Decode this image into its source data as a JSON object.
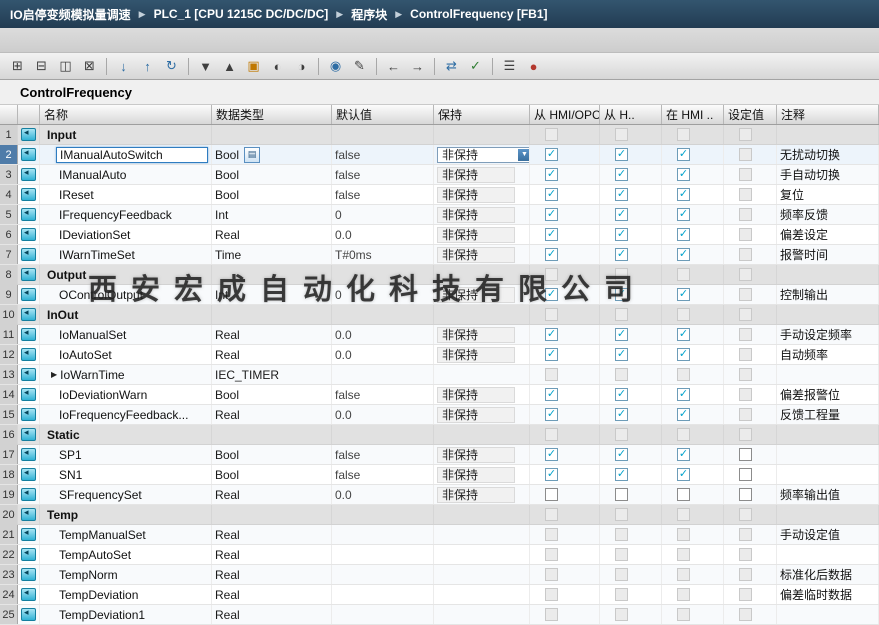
{
  "breadcrumb": {
    "items": [
      "IO启停变频模拟量调速",
      "PLC_1 [CPU 1215C DC/DC/DC]",
      "程序块",
      "ControlFrequency [FB1]"
    ]
  },
  "icons": {
    "crumb_sep": "▶",
    "check": "✓",
    "dropdown": "▼",
    "expander_open": "▼",
    "expander_closed": "▶",
    "type_browse": "▤"
  },
  "toolbar": {
    "icons": [
      {
        "name": "insert-row-icon",
        "glyph": "⊞",
        "color": "#3f3f3f"
      },
      {
        "name": "add-row-icon",
        "glyph": "⊟",
        "color": "#3f3f3f"
      },
      {
        "name": "copy-row-icon",
        "glyph": "◫",
        "color": "#3f3f3f"
      },
      {
        "name": "delete-row-icon",
        "glyph": "⊠",
        "color": "#3f3f3f"
      },
      {
        "sep": true
      },
      {
        "name": "import-icon",
        "glyph": "↓",
        "color": "#2e6da4"
      },
      {
        "name": "export-icon",
        "glyph": "↑",
        "color": "#2e6da4"
      },
      {
        "name": "refresh-icon",
        "glyph": "↻",
        "color": "#2e6da4"
      },
      {
        "sep": true
      },
      {
        "name": "expand-all-icon",
        "glyph": "▼",
        "color": "#3f3f3f"
      },
      {
        "name": "collapse-all-icon",
        "glyph": "▲",
        "color": "#3f3f3f"
      },
      {
        "name": "keep-actual-values-icon",
        "glyph": "▣",
        "color": "#c07800"
      },
      {
        "name": "snapshot-icon",
        "glyph": "◐",
        "color": "#3f3f3f"
      },
      {
        "name": "load-snapshot-icon",
        "glyph": "◑",
        "color": "#3f3f3f"
      },
      {
        "sep": true
      },
      {
        "name": "monitor-icon",
        "glyph": "◉",
        "color": "#2e6da4"
      },
      {
        "name": "modify-icon",
        "glyph": "✎",
        "color": "#3f3f3f"
      },
      {
        "sep": true
      },
      {
        "name": "previous-icon",
        "glyph": "←",
        "color": "#3f3f3f"
      },
      {
        "name": "next-icon",
        "glyph": "→",
        "color": "#3f3f3f"
      },
      {
        "sep": true
      },
      {
        "name": "sync-online-icon",
        "glyph": "⇄",
        "color": "#2e6da4"
      },
      {
        "name": "compile-icon",
        "glyph": "✓",
        "color": "#2f7d32"
      },
      {
        "sep": true
      },
      {
        "name": "settings-icon",
        "glyph": "☰",
        "color": "#3f3f3f"
      },
      {
        "name": "status-icon",
        "glyph": "●",
        "color": "#b3382e"
      }
    ]
  },
  "editor": {
    "title": "ControlFrequency"
  },
  "watermark": {
    "text": "西安宏成自动化科技有限公司"
  },
  "table": {
    "headers": {
      "name": "名称",
      "data_type": "数据类型",
      "default": "默认值",
      "retain": "保持",
      "from_hmi_opc": "从 HMI/OPC..",
      "from_hmi": "从 H..",
      "in_hmi": "在 HMI ..",
      "setpoint": "设定值",
      "comment": "注释"
    },
    "rows": [
      {
        "num": 1,
        "kind": "section",
        "name": "Input",
        "checks": [
          "d",
          "d",
          "d",
          "d"
        ]
      },
      {
        "num": 2,
        "kind": "var",
        "selected": true,
        "name": "IManualAutoSwitch",
        "type": "Bool",
        "type_browse": true,
        "default": "false",
        "retain": "非保持",
        "retain_dropdown": true,
        "checks": [
          "c",
          "c",
          "c",
          "d"
        ],
        "comment": "无扰动切换"
      },
      {
        "num": 3,
        "kind": "var",
        "name": "IManualAuto",
        "type": "Bool",
        "default": "false",
        "retain": "非保持",
        "checks": [
          "c",
          "c",
          "c",
          "d"
        ],
        "comment": "手自动切换"
      },
      {
        "num": 4,
        "kind": "var",
        "name": "IReset",
        "type": "Bool",
        "default": "false",
        "retain": "非保持",
        "checks": [
          "c",
          "c",
          "c",
          "d"
        ],
        "comment": "复位"
      },
      {
        "num": 5,
        "kind": "var",
        "name": "IFrequencyFeedback",
        "type": "Int",
        "default": "0",
        "retain": "非保持",
        "checks": [
          "c",
          "c",
          "c",
          "d"
        ],
        "comment": "频率反馈"
      },
      {
        "num": 6,
        "kind": "var",
        "name": "IDeviationSet",
        "type": "Real",
        "default": "0.0",
        "retain": "非保持",
        "checks": [
          "c",
          "c",
          "c",
          "d"
        ],
        "comment": "偏差设定"
      },
      {
        "num": 7,
        "kind": "var",
        "name": "IWarnTimeSet",
        "type": "Time",
        "default": "T#0ms",
        "retain": "非保持",
        "checks": [
          "c",
          "c",
          "c",
          "d"
        ],
        "comment": "报警时间"
      },
      {
        "num": 8,
        "kind": "section",
        "name": "Output",
        "checks": [
          "d",
          "d",
          "d",
          "d"
        ]
      },
      {
        "num": 9,
        "kind": "var",
        "name": "OControlOutput",
        "type": "Int",
        "default": "0",
        "retain": "非保持",
        "checks": [
          "c",
          "c",
          "c",
          "d"
        ],
        "comment": "控制输出"
      },
      {
        "num": 10,
        "kind": "section",
        "name": "InOut",
        "checks": [
          "d",
          "d",
          "d",
          "d"
        ]
      },
      {
        "num": 11,
        "kind": "var",
        "name": "IoManualSet",
        "type": "Real",
        "default": "0.0",
        "retain": "非保持",
        "checks": [
          "c",
          "c",
          "c",
          "d"
        ],
        "comment": "手动设定频率"
      },
      {
        "num": 12,
        "kind": "var",
        "name": "IoAutoSet",
        "type": "Real",
        "default": "0.0",
        "retain": "非保持",
        "checks": [
          "c",
          "c",
          "c",
          "d"
        ],
        "comment": "自动频率"
      },
      {
        "num": 13,
        "kind": "var",
        "name": "IoWarnTime",
        "type": "IEC_TIMER",
        "default": "",
        "retain": "",
        "expander": "closed",
        "checks": [
          "d",
          "d",
          "d",
          "d"
        ],
        "comment": ""
      },
      {
        "num": 14,
        "kind": "var",
        "name": "IoDeviationWarn",
        "type": "Bool",
        "default": "false",
        "retain": "非保持",
        "checks": [
          "c",
          "c",
          "c",
          "d"
        ],
        "comment": "偏差报警位"
      },
      {
        "num": 15,
        "kind": "var",
        "name": "IoFrequencyFeedback...",
        "type": "Real",
        "default": "0.0",
        "retain": "非保持",
        "checks": [
          "c",
          "c",
          "c",
          "d"
        ],
        "comment": "反馈工程量"
      },
      {
        "num": 16,
        "kind": "section",
        "name": "Static",
        "checks": [
          "d",
          "d",
          "d",
          "d"
        ]
      },
      {
        "num": 17,
        "kind": "var",
        "name": "SP1",
        "type": "Bool",
        "default": "false",
        "retain": "非保持",
        "checks": [
          "c",
          "c",
          "c",
          "e"
        ],
        "comment": ""
      },
      {
        "num": 18,
        "kind": "var",
        "name": "SN1",
        "type": "Bool",
        "default": "false",
        "retain": "非保持",
        "checks": [
          "c",
          "c",
          "c",
          "e"
        ],
        "comment": ""
      },
      {
        "num": 19,
        "kind": "var",
        "name": "SFrequencySet",
        "type": "Real",
        "default": "0.0",
        "retain": "非保持",
        "checks": [
          "e",
          "e",
          "e",
          "e"
        ],
        "comment": "频率输出值"
      },
      {
        "num": 20,
        "kind": "section",
        "name": "Temp",
        "checks": [
          "d",
          "d",
          "d",
          "d"
        ]
      },
      {
        "num": 21,
        "kind": "var",
        "name": "TempManualSet",
        "type": "Real",
        "default": "",
        "retain": "",
        "checks": [
          "d",
          "d",
          "d",
          "d"
        ],
        "comment": "手动设定值"
      },
      {
        "num": 22,
        "kind": "var",
        "name": "TempAutoSet",
        "type": "Real",
        "default": "",
        "retain": "",
        "checks": [
          "d",
          "d",
          "d",
          "d"
        ],
        "comment": ""
      },
      {
        "num": 23,
        "kind": "var",
        "name": "TempNorm",
        "type": "Real",
        "default": "",
        "retain": "",
        "checks": [
          "d",
          "d",
          "d",
          "d"
        ],
        "comment": "标准化后数据"
      },
      {
        "num": 24,
        "kind": "var",
        "name": "TempDeviation",
        "type": "Real",
        "default": "",
        "retain": "",
        "checks": [
          "d",
          "d",
          "d",
          "d"
        ],
        "comment": "偏差临时数据"
      },
      {
        "num": 25,
        "kind": "var",
        "name": "TempDeviation1",
        "type": "Real",
        "default": "",
        "retain": "",
        "checks": [
          "d",
          "d",
          "d",
          "d"
        ],
        "comment": ""
      }
    ]
  }
}
